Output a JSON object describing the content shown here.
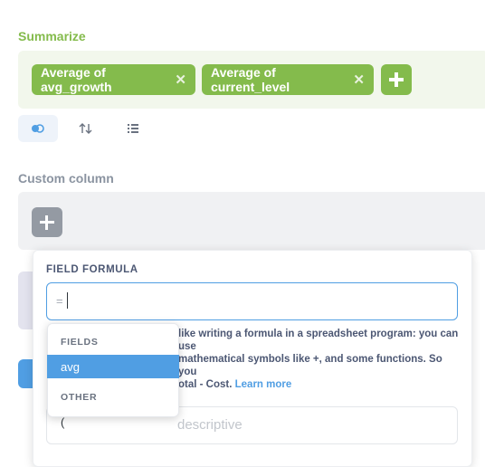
{
  "summarize": {
    "title": "Summarize",
    "metrics": [
      "Average of avg_growth",
      "Average of current_level"
    ],
    "remove_icon": "close-icon",
    "add_icon": "plus-icon"
  },
  "step_actions": {
    "icons": [
      "toggle-preview-icon",
      "sort-icon",
      "list-limit-icon"
    ]
  },
  "custom_column": {
    "title": "Custom column",
    "add_icon": "plus-icon"
  },
  "popover": {
    "field_label": "FIELD FORMULA",
    "formula_prefix": "=",
    "formula_value": "",
    "help_line1": "like writing a formula in a spreadsheet program: you can use",
    "help_line2": "mathematical symbols like +, and some functions. So you",
    "help_line3": "otal - Cost.",
    "help_link": "Learn more",
    "name_placeholder": "descriptive"
  },
  "suggestions": {
    "fields_header": "FIELDS",
    "fields": [
      "avg"
    ],
    "other_header": "OTHER",
    "other": [
      "("
    ]
  },
  "colors": {
    "summarize_green": "#84bb4c",
    "brand_blue": "#509ee3",
    "text_dark": "#4c5773"
  }
}
